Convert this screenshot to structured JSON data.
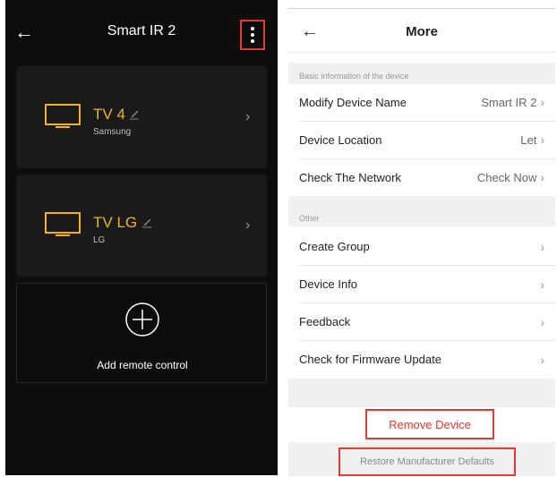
{
  "left": {
    "title": "Smart IR 2",
    "devices": [
      {
        "name": "TV 4",
        "brand": "Samsung"
      },
      {
        "name": "TV  LG",
        "brand": "LG"
      }
    ],
    "add_label": "Add remote control"
  },
  "right": {
    "title": "More",
    "section1_label": "Basic information of the device",
    "rows1": [
      {
        "label": "Modify Device Name",
        "value": "Smart IR 2"
      },
      {
        "label": "Device Location",
        "value": "Let"
      },
      {
        "label": "Check The Network",
        "value": "Check Now"
      }
    ],
    "section2_label": "Other",
    "rows2": [
      {
        "label": "Create Group",
        "value": ""
      },
      {
        "label": "Device Info",
        "value": ""
      },
      {
        "label": "Feedback",
        "value": ""
      },
      {
        "label": "Check for Firmware Update",
        "value": ""
      }
    ],
    "remove_label": "Remove Device",
    "restore_label": "Restore Manufacturer Defaults"
  },
  "colors": {
    "accent": "#f3b318",
    "highlight": "#e53935",
    "dark_bg": "#0d0d0d"
  }
}
